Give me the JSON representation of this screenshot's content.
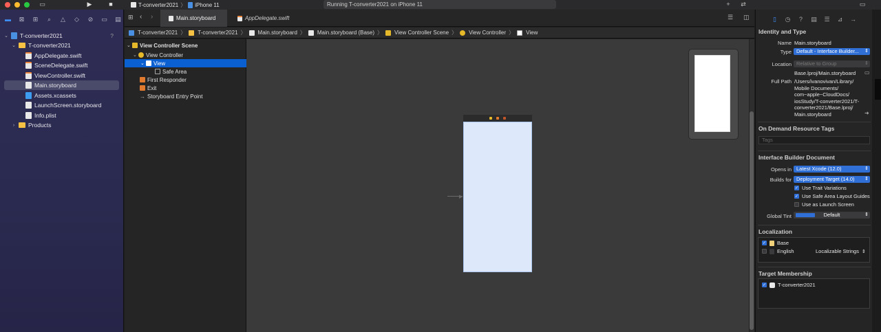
{
  "toolbar": {
    "project": "T-converter2021",
    "device": "iPhone 11",
    "status": "Running T-converter2021 on iPhone 11"
  },
  "navigator": {
    "project_badge": "?",
    "items": [
      {
        "label": "T-converter2021",
        "kind": "project"
      },
      {
        "label": "T-converter2021",
        "kind": "folder"
      },
      {
        "label": "AppDelegate.swift",
        "kind": "swift"
      },
      {
        "label": "SceneDelegate.swift",
        "kind": "swift"
      },
      {
        "label": "ViewController.swift",
        "kind": "swift"
      },
      {
        "label": "Main.storyboard",
        "kind": "storyboard"
      },
      {
        "label": "Assets.xcassets",
        "kind": "assets"
      },
      {
        "label": "LaunchScreen.storyboard",
        "kind": "storyboard"
      },
      {
        "label": "Info.plist",
        "kind": "plist"
      },
      {
        "label": "Products",
        "kind": "folder"
      }
    ]
  },
  "tabs": [
    {
      "label": "Main.storyboard"
    },
    {
      "label": "AppDelegate.swift"
    }
  ],
  "jumpbar": [
    "T-converter2021",
    "T-converter2021",
    "Main.storyboard",
    "Main.storyboard (Base)",
    "View Controller Scene",
    "View Controller",
    "View"
  ],
  "outline": [
    "View Controller Scene",
    "View Controller",
    "View",
    "Safe Area",
    "First Responder",
    "Exit",
    "Storyboard Entry Point"
  ],
  "inspector": {
    "identity_title": "Identity and Type",
    "name_label": "Name",
    "name_value": "Main.storyboard",
    "type_label": "Type",
    "type_value": "Default - Interface Builder...",
    "location_label": "Location",
    "location_value": "Relative to Group",
    "location_path": "Base.lproj/Main.storyboard",
    "fullpath_label": "Full Path",
    "fullpath_lines": [
      "/Users/ivanovivan/Library/",
      "Mobile Documents/",
      "com~apple~CloudDocs/",
      "iosStudy/T-converter2021/T-",
      "converter2021/Base.lproj/",
      "Main.storyboard"
    ],
    "odr_title": "On Demand Resource Tags",
    "tags_placeholder": "Tags",
    "ibdoc_title": "Interface Builder Document",
    "opens_label": "Opens in",
    "opens_value": "Latest Xcode (12.0)",
    "builds_label": "Builds for",
    "builds_value": "Deployment Target (14.0)",
    "checks": [
      {
        "label": "Use Trait Variations",
        "checked": true
      },
      {
        "label": "Use Safe Area Layout Guides",
        "checked": true
      },
      {
        "label": "Use as Launch Screen",
        "checked": false
      }
    ],
    "tint_label": "Global Tint",
    "tint_value": "Default",
    "localization_title": "Localization",
    "localizations": [
      {
        "label": "Base",
        "checked": true,
        "extra": ""
      },
      {
        "label": "English",
        "checked": false,
        "extra": "Localizable Strings"
      }
    ],
    "membership_title": "Target Membership",
    "membership": [
      {
        "label": "T-converter2021",
        "checked": true
      }
    ]
  },
  "colors": {
    "accent": "#2f6fd6",
    "selection": "#0a5fd1",
    "folder": "#f7c144"
  }
}
